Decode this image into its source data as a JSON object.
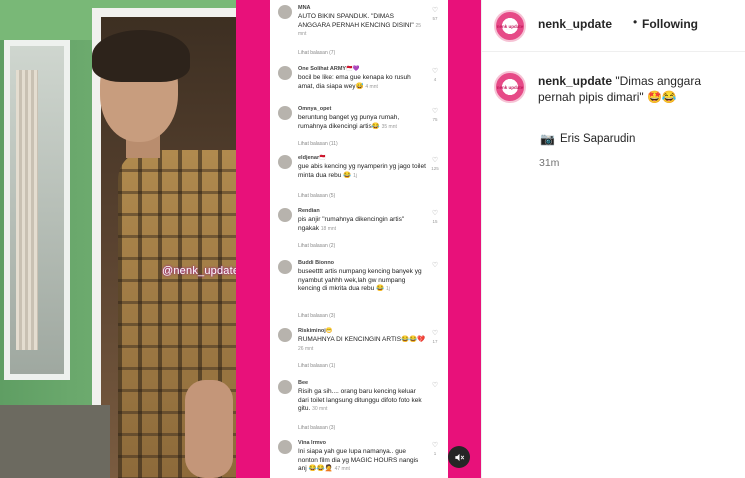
{
  "post": {
    "watermark": "@nenk_update"
  },
  "comments": [
    {
      "user": "MNA",
      "text": "AUTO BIKIN SPANDUK. \"DIMAS ANGGARA PERNAH KENCING DISINI\"",
      "time": "25 mnt",
      "likes": "57",
      "replies": "Lihat balasan (7)"
    },
    {
      "user": "One Solihat ARMY🇲🇨💜",
      "text": "bocil be like: ema gue kenapa ko rusuh amat, dia siapa wey😅",
      "time": "4 mnt",
      "likes": "4",
      "replies": ""
    },
    {
      "user": "Omnya_opet",
      "text": "beruntung banget yg punya rumah, rumahnya dikencingi artis😂",
      "time": "35 mnt",
      "likes": "75",
      "replies": "Lihat balasan (11)"
    },
    {
      "user": "eldjenar🇲🇨",
      "text": "gue abis kencing yg nyamperin yg jago toilet minta dua rebu 😂",
      "time": "1j",
      "likes": "125",
      "replies": "Lihat balasan (5)"
    },
    {
      "user": "Rendian",
      "text": "pis anjir \"rumahnya dikencingin artis\" ngakak",
      "time": "18 mnt",
      "likes": "15",
      "replies": "Lihat balasan (2)"
    },
    {
      "user": "Buddi Bionno",
      "text": "buseetttt artis numpang kencing banyek yg nyambut yahhh wek,lah gw numpang kencing di mkrita dua rebu 😂",
      "time": "1j",
      "likes": "",
      "replies": "Lihat balasan (3)"
    },
    {
      "user": "Riskiminoj😁",
      "text": "RUMAHNYA DI KENCINGIN ARTIS😂😂💔",
      "time": "26 mnt",
      "likes": "17",
      "replies": "Lihat balasan (1)"
    },
    {
      "user": "Bee",
      "text": "Risih ga sih.... orang baru kencing keluar dari toilet langsung ditunggu difoto foto kek gitu.",
      "time": "30 mnt",
      "likes": "",
      "replies": "Lihat balasan (3)"
    },
    {
      "user": "Vina Irmvo",
      "text": "Ini siapa yah gue lupa namanya.. gue nonton film dia yg MAGIC HOURS nangis anj 😂😂🤦",
      "time": "47 mnt",
      "likes": "1",
      "replies": ""
    }
  ],
  "sidebar": {
    "username": "nenk_update",
    "dot": "•",
    "follow_status": "Following",
    "avatar_text": "nenk update",
    "caption_user": "nenk_update",
    "caption_text": "\"Dimas anggara pernah pipis dimari\" 🤩😂",
    "credit_icon": "📷",
    "credit_name": "Eris Saparudin",
    "time_ago": "31m"
  },
  "colors": {
    "media_bg": "#e8117a",
    "text": "#262626",
    "muted": "#737373"
  },
  "icons": {
    "like": "heart-outline-icon",
    "mute": "speaker-muted-icon",
    "credit": "camera-icon"
  }
}
